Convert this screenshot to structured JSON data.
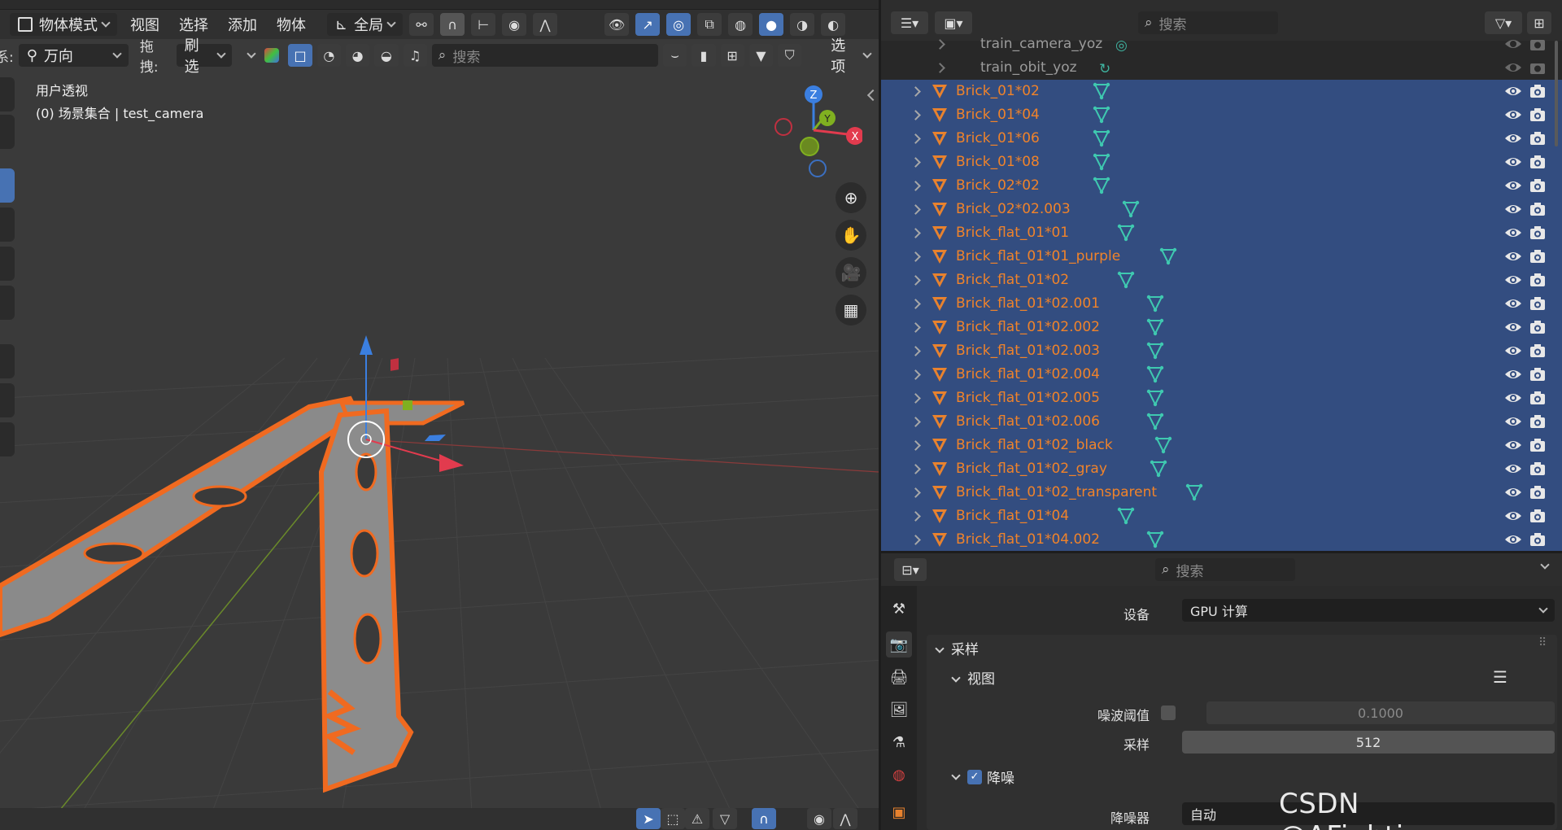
{
  "viewport": {
    "mode_label": "物体模式",
    "menu": [
      "视图",
      "选择",
      "添加",
      "物体"
    ],
    "transform_orientation": "全局",
    "orientation_prefix": "系:",
    "orientation_value": "万向",
    "drag_label": "拖拽:",
    "drag_value": "刷选",
    "search_placeholder": "搜索",
    "options_label": "选项",
    "overlay_view_name": "用户透视",
    "overlay_collection": "(0) 场景集合 | test_camera",
    "gizmo_axes": [
      "Z",
      "Y",
      "X"
    ],
    "colors": {
      "x": "#e23b4e",
      "y": "#80b020",
      "z": "#3b7fe0",
      "accent": "#4772b3",
      "selection": "#f07030"
    }
  },
  "outliner": {
    "search_placeholder": "搜索",
    "child_rows": [
      {
        "name": "train_camera_yoz"
      },
      {
        "name": "train_obit_yoz"
      }
    ],
    "rows": [
      {
        "name": "Brick_01*02"
      },
      {
        "name": "Brick_01*04"
      },
      {
        "name": "Brick_01*06"
      },
      {
        "name": "Brick_01*08"
      },
      {
        "name": "Brick_02*02"
      },
      {
        "name": "Brick_02*02.003"
      },
      {
        "name": "Brick_flat_01*01"
      },
      {
        "name": "Brick_flat_01*01_purple"
      },
      {
        "name": "Brick_flat_01*02"
      },
      {
        "name": "Brick_flat_01*02.001"
      },
      {
        "name": "Brick_flat_01*02.002"
      },
      {
        "name": "Brick_flat_01*02.003"
      },
      {
        "name": "Brick_flat_01*02.004"
      },
      {
        "name": "Brick_flat_01*02.005"
      },
      {
        "name": "Brick_flat_01*02.006"
      },
      {
        "name": "Brick_flat_01*02_black"
      },
      {
        "name": "Brick_flat_01*02_gray"
      },
      {
        "name": "Brick_flat_01*02_transparent"
      },
      {
        "name": "Brick_flat_01*04"
      },
      {
        "name": "Brick_flat_01*04.002"
      }
    ],
    "icons": {
      "object": "mesh-object-icon",
      "data": "mesh-data-icon",
      "visible": "eye-icon",
      "render": "camera-icon"
    }
  },
  "properties": {
    "search_placeholder": "搜索",
    "device_label": "设备",
    "device_value": "GPU 计算",
    "sampling_panel": "采样",
    "viewport_subpanel": "视图",
    "noise_threshold_label": "噪波阈值",
    "noise_threshold_value": "0.1000",
    "samples_label": "采样",
    "samples_value": "512",
    "denoise_label": "降噪",
    "denoiser_label": "降噪器",
    "denoiser_value": "自动"
  },
  "watermark": "CSDN @AFightingguy"
}
